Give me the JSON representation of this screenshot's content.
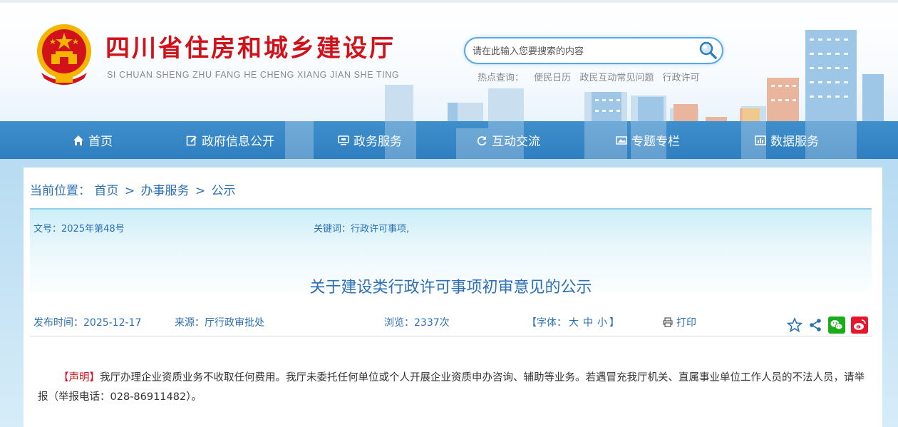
{
  "header": {
    "title": "四川省住房和城乡建设厅",
    "pinyin": "SI CHUAN SHENG ZHU FANG HE CHENG XIANG JIAN SHE TING",
    "search_placeholder": "请在此输入您要搜索的内容",
    "hot_label": "热点查询：",
    "hot_links": [
      "便民日历",
      "政民互动常见问题",
      "行政许可"
    ]
  },
  "nav": {
    "items": [
      {
        "label": "首页",
        "icon": "home-icon"
      },
      {
        "label": "政府信息公开",
        "icon": "edit-icon"
      },
      {
        "label": "政务服务",
        "icon": "monitor-icon"
      },
      {
        "label": "互动交流",
        "icon": "refresh-icon"
      },
      {
        "label": "专题专栏",
        "icon": "image-icon"
      },
      {
        "label": "数据服务",
        "icon": "chart-icon"
      }
    ]
  },
  "breadcrumb": {
    "label": "当前位置：",
    "items": [
      "首页",
      "办事服务",
      "公示"
    ],
    "sep": ">"
  },
  "article": {
    "doc_no": "文号：2025年第48号",
    "keywords": "关键词：行政许可事项,",
    "title": "关于建设类行政许可事项初审意见的公示",
    "publish": "发布时间：2025-12-17",
    "source": "来源：厅行政审批处",
    "views": "浏览：2337次",
    "font_label": "【字体：",
    "font_sizes": [
      "大",
      "中",
      "小"
    ],
    "font_close": "】",
    "print": "打印"
  },
  "notice": {
    "label": "【声明】",
    "text": "我厅办理企业资质业务不收取任何费用。我厅未委托任何单位或个人开展企业资质申办咨询、辅助等业务。若遇冒充我厅机关、直属事业单位工作人员的不法人员，请举报（举报电话：028-86911482）。"
  },
  "colors": {
    "brand_red": "#d1121b",
    "nav_blue": "#2f7ebf",
    "link_blue": "#2b6fb5",
    "wechat_green": "#1aad19",
    "weibo_red": "#e6162d"
  }
}
